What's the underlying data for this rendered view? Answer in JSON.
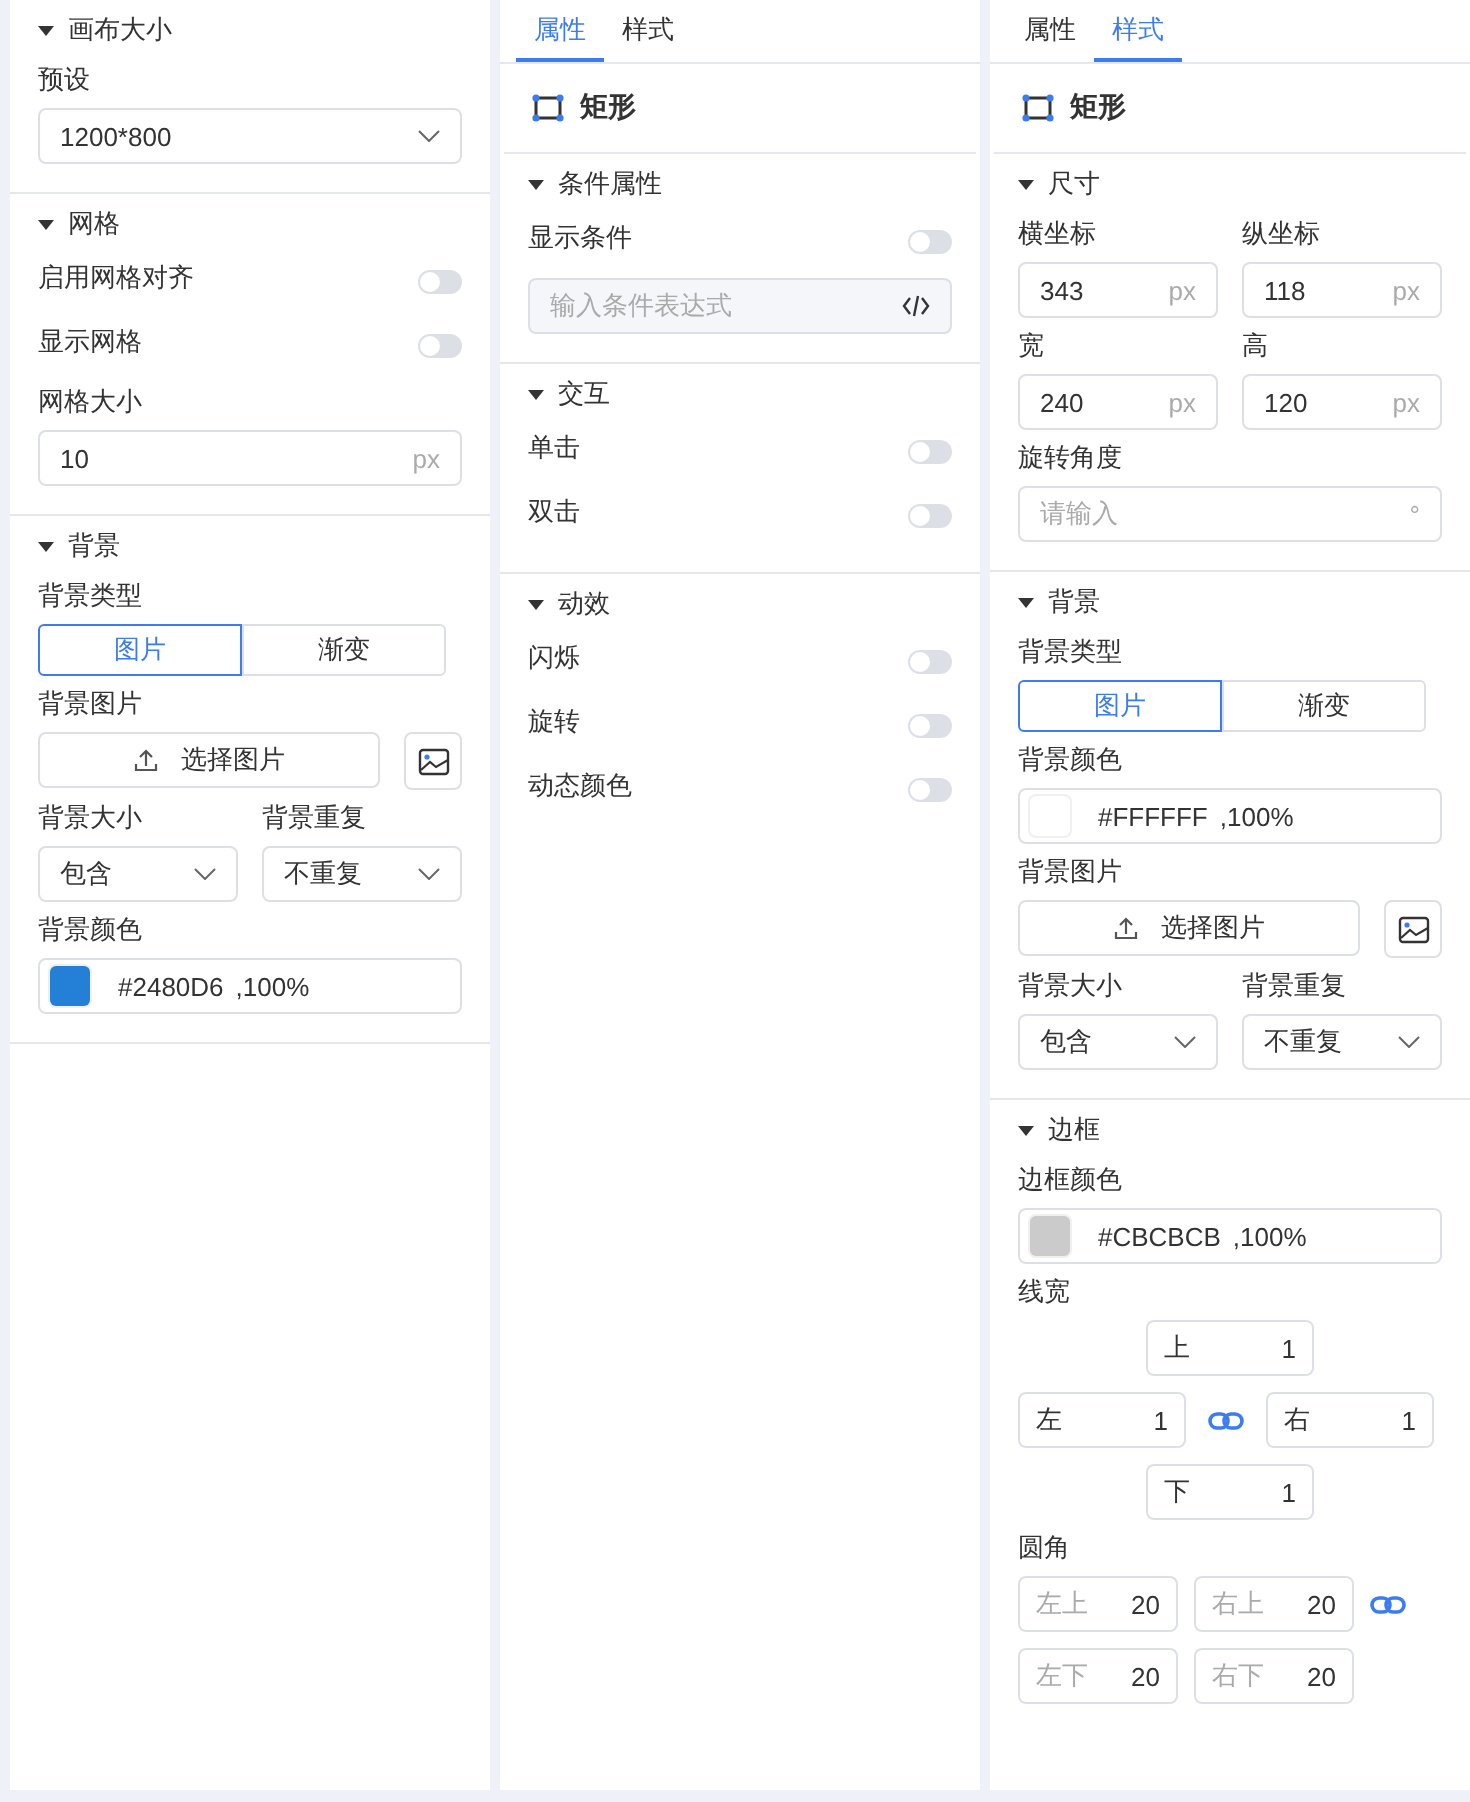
{
  "panels": [
    {
      "sections": [
        {
          "title": "画布大小",
          "expanded": true,
          "rows": [
            {
              "kind": "select",
              "label": "预设",
              "value": "1200*800"
            }
          ]
        },
        {
          "title": "网格",
          "expanded": true,
          "rows": [
            {
              "kind": "toggle",
              "label": "启用网格对齐",
              "on": false
            },
            {
              "kind": "toggle",
              "label": "显示网格",
              "on": false
            },
            {
              "kind": "input",
              "label": "网格大小",
              "value": "10",
              "unit": "px"
            }
          ]
        },
        {
          "title": "背景",
          "expanded": true,
          "rows": [
            {
              "kind": "segmented",
              "label": "背景类型",
              "options": [
                {
                  "label": "图片",
                  "selected": true
                },
                {
                  "label": "渐变",
                  "selected": false
                }
              ]
            },
            {
              "kind": "upload",
              "label": "背景图片",
              "button": "选择图片"
            },
            {
              "kind": "pair",
              "items": [
                {
                  "kind": "select",
                  "label": "背景大小",
                  "value": "包含"
                },
                {
                  "kind": "select",
                  "label": "背景重复",
                  "value": "不重复"
                }
              ]
            },
            {
              "kind": "color",
              "label": "背景颜色",
              "value": "#2480D6",
              "opacity": ",100%"
            }
          ]
        }
      ]
    },
    {
      "tabs": [
        {
          "label": "属性",
          "selected": true
        },
        {
          "label": "样式",
          "selected": false
        }
      ],
      "title": "矩形",
      "sections": [
        {
          "title": "条件属性",
          "expanded": true,
          "rows": [
            {
              "kind": "toggle",
              "label": "显示条件",
              "on": false
            },
            {
              "kind": "expression",
              "placeholder": "输入条件表达式"
            }
          ]
        },
        {
          "title": "交互",
          "expanded": true,
          "rows": [
            {
              "kind": "toggle",
              "label": "单击",
              "on": false
            },
            {
              "kind": "toggle",
              "label": "双击",
              "on": false
            }
          ]
        },
        {
          "title": "动效",
          "expanded": true,
          "rows": [
            {
              "kind": "toggle",
              "label": "闪烁",
              "on": false
            },
            {
              "kind": "toggle",
              "label": "旋转",
              "on": false
            },
            {
              "kind": "toggle",
              "label": "动态颜色",
              "on": false
            }
          ]
        }
      ]
    },
    {
      "tabs": [
        {
          "label": "属性",
          "selected": false
        },
        {
          "label": "样式",
          "selected": true
        }
      ],
      "title": "矩形",
      "sections": [
        {
          "title": "尺寸",
          "expanded": true,
          "rows": [
            {
              "kind": "pair",
              "items": [
                {
                  "kind": "input",
                  "label": "横坐标",
                  "value": "343",
                  "unit": "px"
                },
                {
                  "kind": "input",
                  "label": "纵坐标",
                  "value": "118",
                  "unit": "px"
                }
              ]
            },
            {
              "kind": "pair",
              "items": [
                {
                  "kind": "input",
                  "label": "宽",
                  "value": "240",
                  "unit": "px"
                },
                {
                  "kind": "input",
                  "label": "高",
                  "value": "120",
                  "unit": "px"
                }
              ]
            },
            {
              "kind": "input",
              "label": "旋转角度",
              "placeholder": "请输入",
              "unit": "°"
            }
          ]
        },
        {
          "title": "背景",
          "expanded": true,
          "rows": [
            {
              "kind": "segmented",
              "label": "背景类型",
              "options": [
                {
                  "label": "图片",
                  "selected": true
                },
                {
                  "label": "渐变",
                  "selected": false
                }
              ]
            },
            {
              "kind": "color",
              "label": "背景颜色",
              "value": "#FFFFFF",
              "opacity": ",100%"
            },
            {
              "kind": "upload",
              "label": "背景图片",
              "button": "选择图片"
            },
            {
              "kind": "pair",
              "items": [
                {
                  "kind": "select",
                  "label": "背景大小",
                  "value": "包含"
                },
                {
                  "kind": "select",
                  "label": "背景重复",
                  "value": "不重复"
                }
              ]
            }
          ]
        },
        {
          "title": "边框",
          "expanded": true,
          "rows": [
            {
              "kind": "color",
              "label": "边框颜色",
              "value": "#CBCBCB",
              "opacity": ",100%"
            },
            {
              "kind": "sides",
              "label": "线宽",
              "top": {
                "label": "上",
                "value": "1"
              },
              "left": {
                "label": "左",
                "value": "1"
              },
              "right": {
                "label": "右",
                "value": "1"
              },
              "bottom": {
                "label": "下",
                "value": "1"
              }
            },
            {
              "kind": "corners",
              "label": "圆角",
              "items": [
                {
                  "label": "左上",
                  "value": "20"
                },
                {
                  "label": "右上",
                  "value": "20"
                },
                {
                  "label": "左下",
                  "value": "20"
                },
                {
                  "label": "右下",
                  "value": "20"
                }
              ]
            }
          ]
        }
      ]
    }
  ]
}
